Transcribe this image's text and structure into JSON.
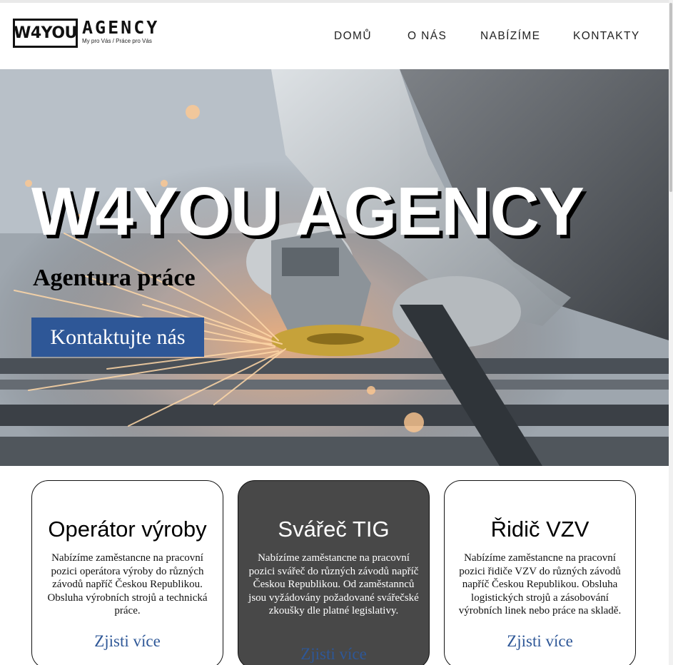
{
  "brand": {
    "logo_box": "W4YOU",
    "logo_word": "AGENCY",
    "tagline": "My pro Vás / Práce pro Vás"
  },
  "nav": {
    "items": [
      {
        "label": "DOMŮ"
      },
      {
        "label": "O NÁS"
      },
      {
        "label": "NABÍZÍME"
      },
      {
        "label": "KONTAKTY"
      }
    ]
  },
  "hero": {
    "title": "W4YOU AGENCY",
    "subtitle": "Agentura práce",
    "cta_label": "Kontaktujte nás"
  },
  "cards": [
    {
      "title": "Operátor výroby",
      "description": "Nabízíme zaměstancne na pracovní pozici operátora výroby do různých závodů napříč Českou Republikou. Obsluha výrobních strojů a technická práce.",
      "link": "Zjisti více",
      "theme": "light"
    },
    {
      "title": "Svářeč TIG",
      "description": "Nabízíme zaměstancne na pracovní pozici svářeč do různých závodů napříč Českou Republikou. Od zaměstannců jsou vyžádovány požadované svářečské zkoušky dle platné legislativy.",
      "link": "Zjisti více",
      "theme": "dark"
    },
    {
      "title": "Řidič VZV",
      "description": "Nabízíme zaměstancne na pracovní pozici řidiče VZV do různých závodů napříč Českou Republikou. Obsluha logistických strojů a zásobování výrobních linek nebo práce na skladě.",
      "link": "Zjisti více",
      "theme": "light"
    }
  ],
  "colors": {
    "accent": "#2e5797",
    "dark_card": "#484848",
    "text": "#111111"
  }
}
